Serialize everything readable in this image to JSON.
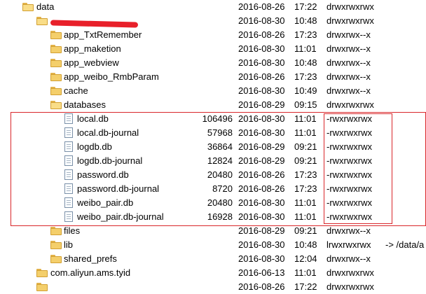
{
  "rows": [
    {
      "name": "data",
      "date": "2016-08-26",
      "time": "17:22",
      "perm": "drwxrwxrwx",
      "kind": "folder",
      "open": true,
      "toggle": "▲",
      "level": 0
    },
    {
      "name": "",
      "date": "2016-08-30",
      "time": "10:48",
      "perm": "drwxrwxrwx",
      "kind": "folder",
      "open": true,
      "toggle": "▲",
      "level": 1,
      "redacted": true
    },
    {
      "name": "app_TxtRemember",
      "date": "2016-08-26",
      "time": "17:23",
      "perm": "drwxrwx--x",
      "kind": "folder",
      "toggle": "▷",
      "level": 2
    },
    {
      "name": "app_maketion",
      "date": "2016-08-30",
      "time": "11:01",
      "perm": "drwxrwx--x",
      "kind": "folder",
      "toggle": "▷",
      "level": 2
    },
    {
      "name": "app_webview",
      "date": "2016-08-30",
      "time": "10:48",
      "perm": "drwxrwx--x",
      "kind": "folder",
      "toggle": "▷",
      "level": 2
    },
    {
      "name": "app_weibo_RmbParam",
      "date": "2016-08-26",
      "time": "17:23",
      "perm": "drwxrwx--x",
      "kind": "folder",
      "toggle": "▷",
      "level": 2
    },
    {
      "name": "cache",
      "date": "2016-08-30",
      "time": "10:49",
      "perm": "drwxrwx--x",
      "kind": "folder",
      "toggle": "▷",
      "level": 2
    },
    {
      "name": "databases",
      "date": "2016-08-29",
      "time": "09:15",
      "perm": "drwxrwxrwx",
      "kind": "folder",
      "open": true,
      "toggle": "▲",
      "level": 2
    },
    {
      "name": "local.db",
      "size": "106496",
      "date": "2016-08-30",
      "time": "11:01",
      "perm": "-rwxrwxrwx",
      "kind": "file",
      "level": 3
    },
    {
      "name": "local.db-journal",
      "size": "57968",
      "date": "2016-08-30",
      "time": "11:01",
      "perm": "-rwxrwxrwx",
      "kind": "file",
      "level": 3
    },
    {
      "name": "logdb.db",
      "size": "36864",
      "date": "2016-08-29",
      "time": "09:21",
      "perm": "-rwxrwxrwx",
      "kind": "file",
      "level": 3
    },
    {
      "name": "logdb.db-journal",
      "size": "12824",
      "date": "2016-08-29",
      "time": "09:21",
      "perm": "-rwxrwxrwx",
      "kind": "file",
      "level": 3
    },
    {
      "name": "password.db",
      "size": "20480",
      "date": "2016-08-26",
      "time": "17:23",
      "perm": "-rwxrwxrwx",
      "kind": "file",
      "level": 3
    },
    {
      "name": "password.db-journal",
      "size": "8720",
      "date": "2016-08-26",
      "time": "17:23",
      "perm": "-rwxrwxrwx",
      "kind": "file",
      "level": 3
    },
    {
      "name": "weibo_pair.db",
      "size": "20480",
      "date": "2016-08-30",
      "time": "11:01",
      "perm": "-rwxrwxrwx",
      "kind": "file",
      "level": 3
    },
    {
      "name": "weibo_pair.db-journal",
      "size": "16928",
      "date": "2016-08-30",
      "time": "11:01",
      "perm": "-rwxrwxrwx",
      "kind": "file",
      "level": 3
    },
    {
      "name": "files",
      "date": "2016-08-29",
      "time": "09:21",
      "perm": "drwxrwx--x",
      "kind": "folder",
      "toggle": "▷",
      "level": 2
    },
    {
      "name": "lib",
      "date": "2016-08-30",
      "time": "10:48",
      "perm": "lrwxrwxrwx",
      "link": "-> /data/a",
      "kind": "folder",
      "level": 2
    },
    {
      "name": "shared_prefs",
      "date": "2016-08-30",
      "time": "12:04",
      "perm": "drwxrwx--x",
      "kind": "folder",
      "toggle": "▷",
      "level": 2
    },
    {
      "name": "com.aliyun.ams.tyid",
      "date": "2016-06-13",
      "time": "11:01",
      "perm": "drwxrwxrwx",
      "kind": "folder",
      "toggle": "▷",
      "level": 1
    },
    {
      "name": "",
      "date": "2016-08-26",
      "time": "17:22",
      "perm": "drwxrwxrwx",
      "kind": "folder",
      "toggle": "▷",
      "level": 1,
      "partial": true
    }
  ],
  "colors": {
    "highlight": "#d9262a",
    "redaction": "#e8202a",
    "folder": "#f4cf6b"
  },
  "icons": {
    "folder": "folder-icon",
    "file": "file-icon",
    "expanded": "expanded-arrow-icon",
    "collapsed": "collapsed-arrow-icon"
  }
}
